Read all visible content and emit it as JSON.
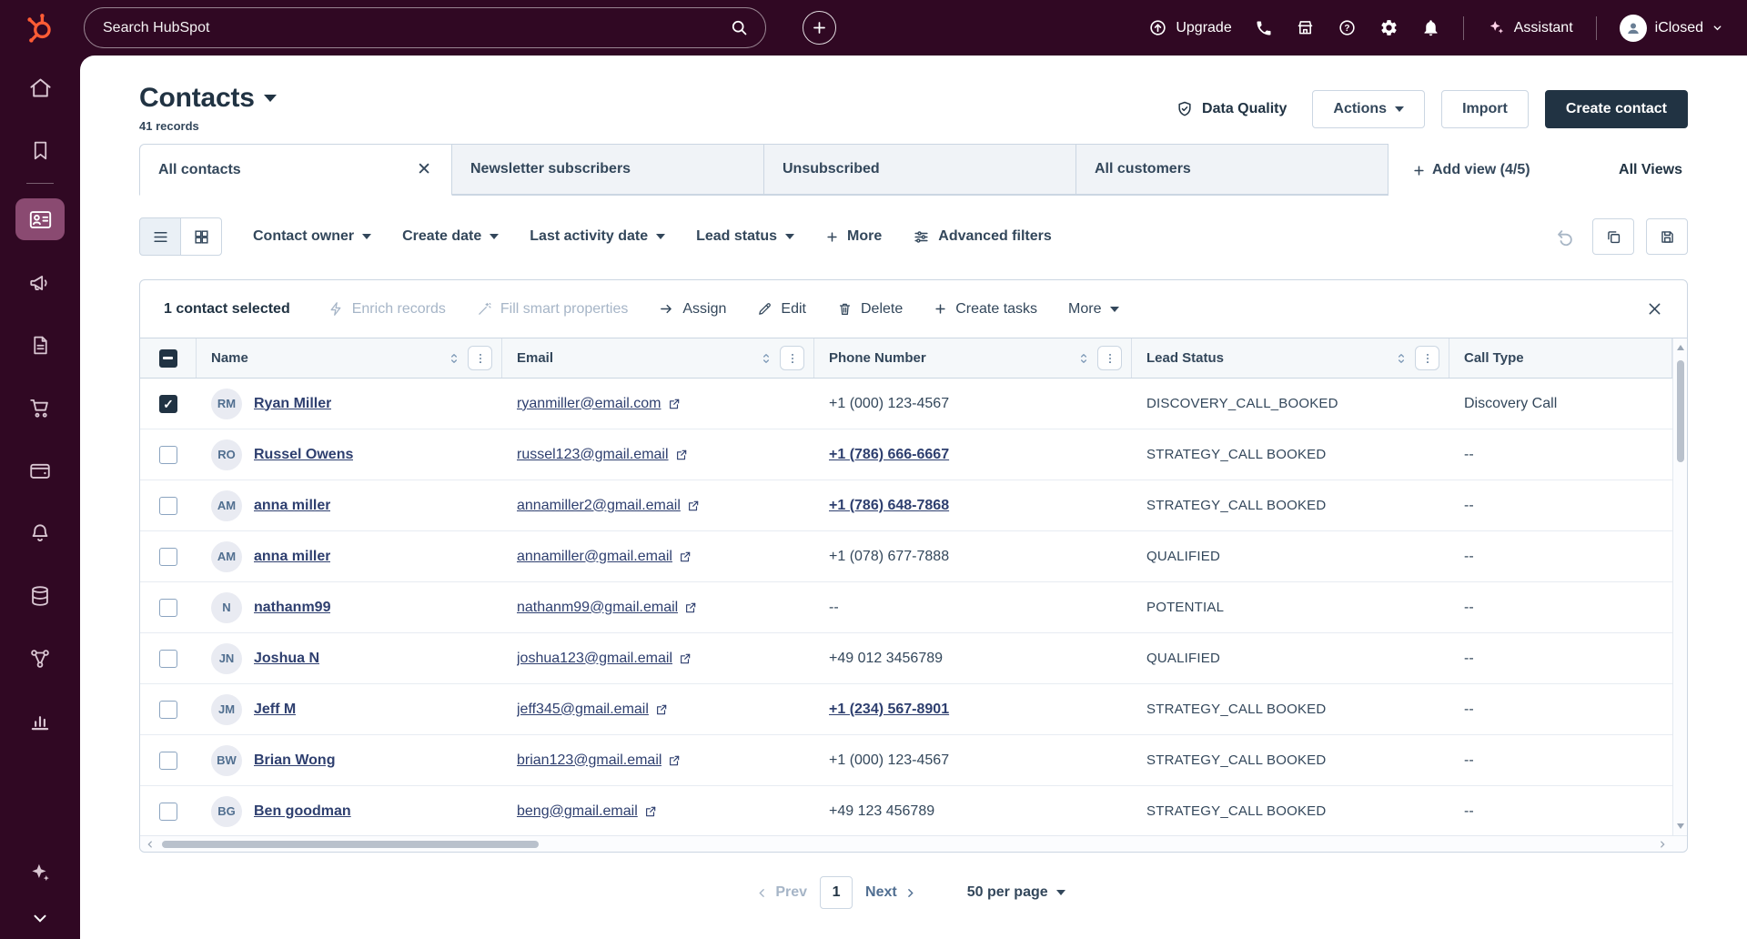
{
  "colors": {
    "topbar_bg": "#300823",
    "nav_active_bg": "#8a4a71",
    "logo_orange": "#ff5c35",
    "link": "#2e3f6f",
    "text": "#33475b",
    "heading": "#213343",
    "border": "#cbd6e2",
    "disabled": "#a6b5c7",
    "dark_button": "#213343",
    "header_bg": "#f5f8fa"
  },
  "icons": {
    "hubspot-logo": "orange sprocket",
    "search": "magnifier",
    "create-new": "plus-circle",
    "upgrade": "circled up arrow",
    "calling": "phone handset",
    "marketplace": "storefront",
    "help": "question circle",
    "settings": "gear",
    "notifications": "bell",
    "assistant": "sparkles",
    "account": "person avatar",
    "data-quality": "shield-check",
    "external-link": "box arrow",
    "sort": "up-down chevrons",
    "column-menu": "vertical kebab",
    "advanced-filters": "sliders"
  },
  "topbar": {
    "search_placeholder": "Search HubSpot",
    "upgrade_label": "Upgrade",
    "assistant_label": "Assistant",
    "account_label": "iClosed"
  },
  "page": {
    "title": "Contacts",
    "record_count": "41 records",
    "data_quality_label": "Data Quality",
    "actions_label": "Actions",
    "import_label": "Import",
    "create_contact_label": "Create contact"
  },
  "views": {
    "tabs": [
      "All contacts",
      "Newsletter subscribers",
      "Unsubscribed",
      "All customers"
    ],
    "add_view_label": "Add view (4/5)",
    "all_views_label": "All Views"
  },
  "filters": {
    "dropdowns": [
      "Contact owner",
      "Create date",
      "Last activity date",
      "Lead status"
    ],
    "more_label": "More",
    "advanced_label": "Advanced filters"
  },
  "selection_bar": {
    "selected_text": "1 contact selected",
    "disabled_actions": [
      "Enrich records",
      "Fill smart properties"
    ],
    "actions": [
      "Assign",
      "Edit",
      "Delete",
      "Create tasks"
    ],
    "more_label": "More"
  },
  "table": {
    "columns": [
      "Name",
      "Email",
      "Phone Number",
      "Lead Status",
      "Call Type"
    ],
    "select_all_indeterminate": true,
    "rows": [
      {
        "initials": "RM",
        "name": "Ryan Miller",
        "email": "ryanmiller@email.com",
        "phone": "+1 (000) 123-4567",
        "phone_link": false,
        "lead_status": "DISCOVERY_CALL_BOOKED",
        "call_type": "Discovery Call",
        "checked": true
      },
      {
        "initials": "RO",
        "name": "Russel Owens",
        "email": "russel123@gmail.email",
        "phone": "+1 (786) 666-6667",
        "phone_link": true,
        "lead_status": "STRATEGY_CALL BOOKED",
        "call_type": "--",
        "checked": false
      },
      {
        "initials": "AM",
        "name": "anna miller",
        "email": "annamiller2@gmail.email",
        "phone": "+1 (786) 648-7868",
        "phone_link": true,
        "lead_status": "STRATEGY_CALL BOOKED",
        "call_type": "--",
        "checked": false
      },
      {
        "initials": "AM",
        "name": "anna miller",
        "email": "annamiller@gmail.email",
        "phone": "+1 (078) 677-7888",
        "phone_link": false,
        "lead_status": "QUALIFIED",
        "call_type": "--",
        "checked": false
      },
      {
        "initials": "N",
        "name": "nathanm99",
        "email": "nathanm99@gmail.email",
        "phone": "--",
        "phone_link": false,
        "lead_status": "POTENTIAL",
        "call_type": "--",
        "checked": false
      },
      {
        "initials": "JN",
        "name": "Joshua N",
        "email": "joshua123@gmail.email",
        "phone": "+49 012 3456789",
        "phone_link": false,
        "lead_status": "QUALIFIED",
        "call_type": "--",
        "checked": false
      },
      {
        "initials": "JM",
        "name": "Jeff M",
        "email": "jeff345@gmail.email",
        "phone": "+1 (234) 567-8901",
        "phone_link": true,
        "lead_status": "STRATEGY_CALL BOOKED",
        "call_type": "--",
        "checked": false
      },
      {
        "initials": "BW",
        "name": "Brian Wong",
        "email": "brian123@gmail.email",
        "phone": "+1 (000) 123-4567",
        "phone_link": false,
        "lead_status": "STRATEGY_CALL BOOKED",
        "call_type": "--",
        "checked": false
      },
      {
        "initials": "BG",
        "name": "Ben goodman",
        "email": "beng@gmail.email",
        "phone": "+49 123 456789",
        "phone_link": false,
        "lead_status": "STRATEGY_CALL BOOKED",
        "call_type": "--",
        "checked": false
      }
    ]
  },
  "pagination": {
    "prev_label": "Prev",
    "page": "1",
    "next_label": "Next",
    "per_page_label": "50 per page"
  }
}
